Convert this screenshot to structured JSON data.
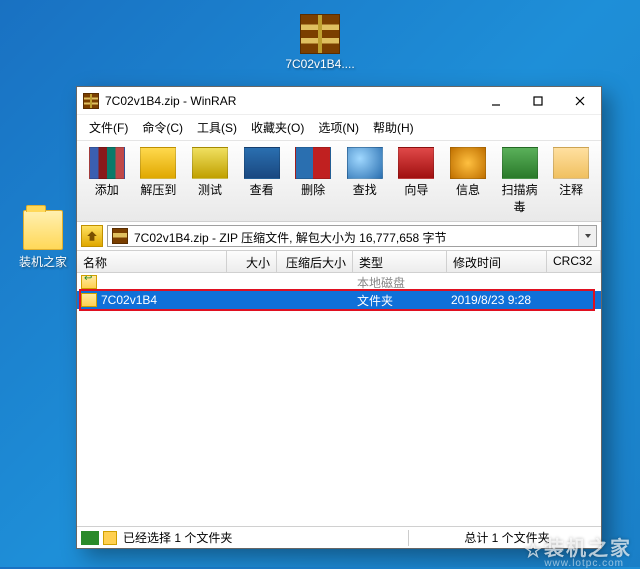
{
  "desktop": {
    "archive_label": "7C02v1B4....",
    "folder_label": "装机之家"
  },
  "window": {
    "title": "7C02v1B4.zip - WinRAR"
  },
  "menu": {
    "file": "文件(F)",
    "command": "命令(C)",
    "tools": "工具(S)",
    "favorites": "收藏夹(O)",
    "options": "选项(N)",
    "help": "帮助(H)"
  },
  "toolbar": {
    "add": "添加",
    "extract": "解压到",
    "test": "测试",
    "view": "查看",
    "delete": "删除",
    "find": "查找",
    "wizard": "向导",
    "info": "信息",
    "scan": "扫描病毒",
    "comment": "注释"
  },
  "path": {
    "text": "7C02v1B4.zip - ZIP 压缩文件, 解包大小为 16,777,658 字节"
  },
  "columns": {
    "name": "名称",
    "size": "大小",
    "packed": "压缩后大小",
    "type": "类型",
    "modified": "修改时间",
    "crc": "CRC32"
  },
  "rows": {
    "up_type_hint": "本地磁盘",
    "entry": {
      "name": "7C02v1B4",
      "type": "文件夹",
      "modified": "2019/8/23 9:28"
    }
  },
  "status": {
    "left": "已经选择 1 个文件夹",
    "right": "总计 1 个文件夹"
  },
  "watermark": {
    "main": "装机之家",
    "sub": "www.lotpc.com"
  }
}
